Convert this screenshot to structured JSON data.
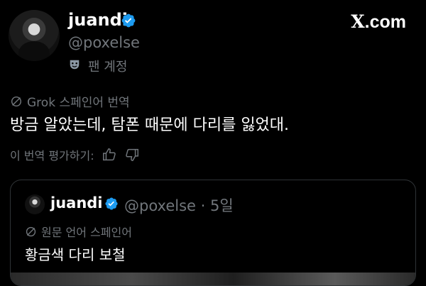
{
  "author": {
    "name": "juandi",
    "handle": "@poxelse",
    "account_label": "팬 계정",
    "account_label_icon": "theater-mask-icon"
  },
  "brand": {
    "text": "X.com",
    "x": "X",
    "rest": ".com"
  },
  "translation": {
    "label": "Grok 스페인어 번역",
    "text": "방금 알았는데, 탐폰 때문에 다리를 잃었대.",
    "rate_label": "이 번역 평가하기:"
  },
  "quoted": {
    "name": "juandi",
    "handle": "@poxelse · 5일",
    "original_label": "원문 언어 스페인어",
    "text": "황금색 다리 보철"
  },
  "colors": {
    "background": "#000000",
    "verified": "#1d9bf0",
    "muted": "#71767b"
  }
}
